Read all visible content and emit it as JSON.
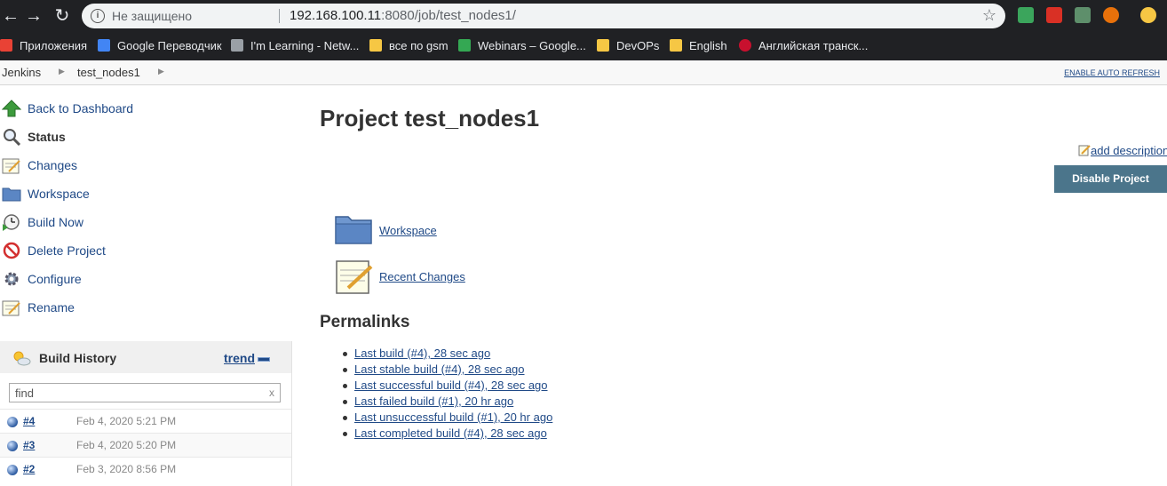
{
  "browser": {
    "not_secure_label": "Не защищено",
    "url_host": "192.168.100.11",
    "url_rest": ":8080/job/test_nodes1/"
  },
  "bookmarks": [
    {
      "label": "Приложения",
      "icon": "apps-grid-icon",
      "color": "#e8eaed"
    },
    {
      "label": "Google Переводчик",
      "icon": "google-translate-icon",
      "color": "#4285f4"
    },
    {
      "label": "I'm Learning - Netw...",
      "icon": "cisco-icon",
      "color": "#9aa0a6"
    },
    {
      "label": "все по gsm",
      "icon": "folder-icon",
      "color": "#f6c744"
    },
    {
      "label": "Webinars – Google...",
      "icon": "google-drive-icon",
      "color": "#34a853"
    },
    {
      "label": "DevOPs",
      "icon": "folder-icon",
      "color": "#f6c744"
    },
    {
      "label": "English",
      "icon": "folder-icon",
      "color": "#f6c744"
    },
    {
      "label": "Английская транск...",
      "icon": "uk-flag-icon",
      "color": "#c8102e"
    }
  ],
  "breadcrumbs": {
    "root": "Jenkins",
    "job": "test_nodes1",
    "auto_refresh": "ENABLE AUTO REFRESH"
  },
  "sidebar": {
    "tasks": [
      {
        "label": "Back to Dashboard",
        "icon": "up-arrow-icon",
        "bold": false
      },
      {
        "label": "Status",
        "icon": "search-icon",
        "bold": true
      },
      {
        "label": "Changes",
        "icon": "notepad-icon",
        "bold": false
      },
      {
        "label": "Workspace",
        "icon": "folder-icon",
        "bold": false
      },
      {
        "label": "Build Now",
        "icon": "clock-icon",
        "bold": false
      },
      {
        "label": "Delete Project",
        "icon": "no-entry-icon",
        "bold": false
      },
      {
        "label": "Configure",
        "icon": "gear-icon",
        "bold": false
      },
      {
        "label": "Rename",
        "icon": "notepad-icon",
        "bold": false
      }
    ]
  },
  "build_history": {
    "title": "Build History",
    "trend": "trend",
    "find_placeholder": "find",
    "clear": "x",
    "builds": [
      {
        "number": "#4",
        "date": "Feb 4, 2020 5:21 PM"
      },
      {
        "number": "#3",
        "date": "Feb 4, 2020 5:20 PM"
      },
      {
        "number": "#2",
        "date": "Feb 3, 2020 8:56 PM"
      }
    ]
  },
  "main": {
    "title": "Project test_nodes1",
    "add_description": "add description",
    "disable_button": "Disable Project",
    "workspace_link": "Workspace",
    "recent_changes_link": "Recent Changes",
    "permalinks_heading": "Permalinks",
    "permalinks": [
      "Last build (#4), 28 sec ago",
      "Last stable build (#4), 28 sec ago",
      "Last successful build (#4), 28 sec ago",
      "Last failed build (#1), 20 hr ago",
      "Last unsuccessful build (#1), 20 hr ago",
      "Last completed build (#4), 28 sec ago"
    ]
  }
}
